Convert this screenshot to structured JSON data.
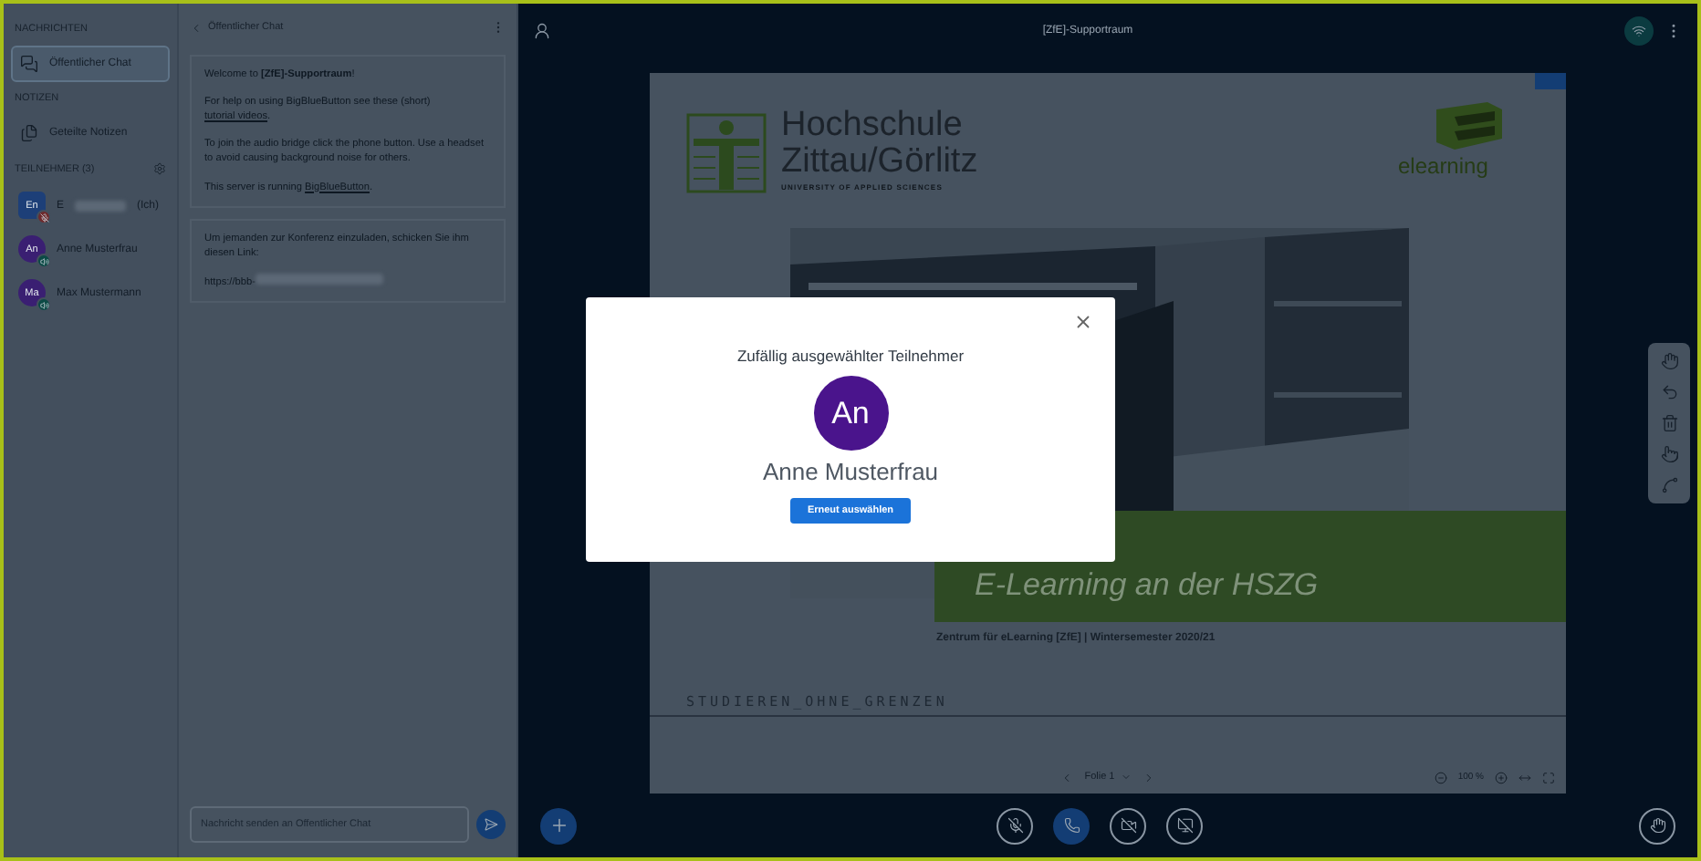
{
  "sidebar": {
    "sections": [
      {
        "heading": "NACHRICHTEN",
        "items": [
          {
            "kind": "chat",
            "label": "Öffentlicher Chat",
            "selected": true
          }
        ]
      },
      {
        "heading": "NOTIZEN",
        "items": [
          {
            "kind": "notes",
            "label": "Geteilte Notizen",
            "selected": false
          }
        ]
      }
    ],
    "participants": {
      "heading": "TEILNEHMER (3)",
      "users": [
        {
          "kind": "moderator",
          "initials": "En",
          "name": "E",
          "suffix": "(Ich)",
          "name_hidden": true,
          "color": "#1d3f78",
          "muted": true
        },
        {
          "kind": "viewer",
          "initials": "An",
          "name": "Anne Musterfrau",
          "name_hidden": false,
          "color": "#3a1f72",
          "muted": false
        },
        {
          "kind": "viewer",
          "initials": "Ma",
          "name": "Max Mustermann",
          "name_hidden": false,
          "color": "#3a1f72",
          "muted": false
        }
      ]
    }
  },
  "chat": {
    "title": "Öffentlicher Chat",
    "messages": [
      {
        "paragraphs": [
          [
            {
              "text": "Welcome to **[ZfE]-Supportraum**!",
              "link": false
            }
          ],
          [
            {
              "text": "For help on using BigBlueButton see these (short) ",
              "link": false
            },
            {
              "text": "tutorial videos",
              "link": true
            },
            {
              "text": ".",
              "link": false
            }
          ],
          [
            {
              "text": "To join the audio bridge click the phone button. Use a headset to avoid causing background noise for others.",
              "link": false
            }
          ],
          [
            {
              "text": "This server is running ",
              "link": false
            },
            {
              "text": "BigBlueButton",
              "link": true
            },
            {
              "text": ".",
              "link": false
            }
          ]
        ]
      },
      {
        "paragraphs": [
          [
            {
              "text": "Um jemanden zur Konferenz einzuladen, schicken Sie ihm diesen Link:",
              "link": false
            }
          ],
          [
            {
              "text": "https://bbb-",
              "link": false,
              "hidden_rest": true
            }
          ]
        ]
      }
    ],
    "input": {
      "placeholder": "Nachricht senden an Öffentlicher Chat"
    }
  },
  "main": {
    "title": "[ZfE]-Supportraum",
    "slide": {
      "logo_title": "Hochschule",
      "logo_subtitle": "Zittau/Görlitz",
      "logo_tagline": "UNIVERSITY OF APPLIED SCIENCES",
      "elearning": "elearning",
      "band_text": "E-Learning an der HSZG",
      "footer": "Zentrum für eLearning [ZfE] | Wintersemester 2020/21",
      "motto": "STUDIEREN_OHNE_GRENZEN"
    },
    "controls": {
      "page": "Folie 1",
      "zoom": "100 %"
    }
  },
  "modal": {
    "title": "Zufällig ausgewählter Teilnehmer",
    "initials": "An",
    "color": "#4a148c",
    "name": "Anne Musterfrau",
    "button": "Erneut auswählen"
  }
}
